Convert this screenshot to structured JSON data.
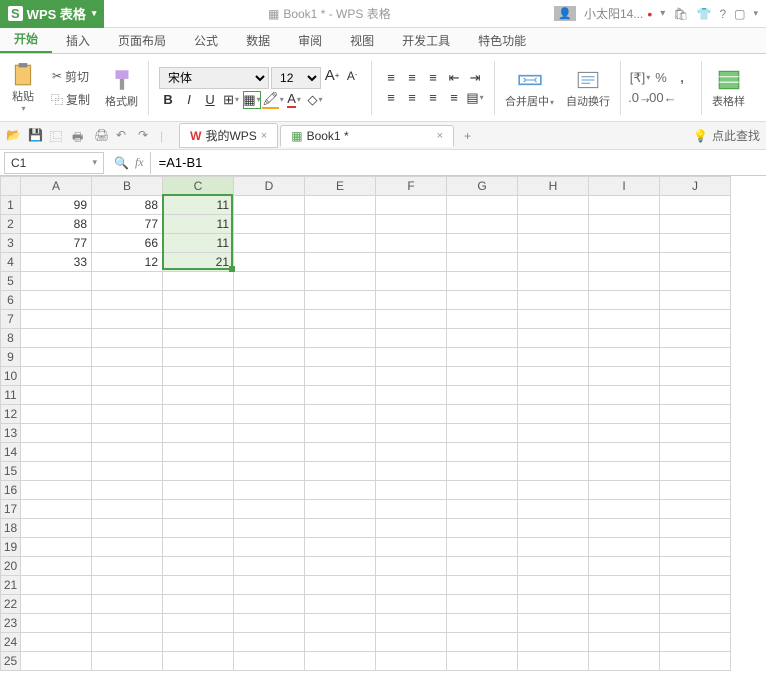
{
  "title": {
    "app": "WPS 表格",
    "doc": "Book1 * - WPS 表格"
  },
  "user": {
    "name": "小太阳14..."
  },
  "menu": {
    "tabs": [
      "开始",
      "插入",
      "页面布局",
      "公式",
      "数据",
      "审阅",
      "视图",
      "开发工具",
      "特色功能"
    ],
    "active": 0
  },
  "ribbon": {
    "paste": "粘贴",
    "cut": "剪切",
    "copy": "复制",
    "format_painter": "格式刷",
    "font_name": "宋体",
    "font_size": "12",
    "merge": "合并居中",
    "wrap": "自动换行",
    "table_style": "表格样"
  },
  "quickbar": {
    "wps_home": "我的WPS",
    "doc_tab": "Book1 *",
    "help": "点此查找"
  },
  "formula": {
    "cell_ref": "C1",
    "formula": "=A1-B1",
    "fx": "fx"
  },
  "chart_data": {
    "type": "table",
    "columns": [
      "A",
      "B",
      "C",
      "D",
      "E",
      "F",
      "G",
      "H",
      "I",
      "J"
    ],
    "rows": [
      {
        "A": 99,
        "B": 88,
        "C": 11
      },
      {
        "A": 88,
        "B": 77,
        "C": 11
      },
      {
        "A": 77,
        "B": 66,
        "C": 11
      },
      {
        "A": 33,
        "B": 12,
        "C": 21
      }
    ],
    "total_rows": 25,
    "selected_range": "C1:C4",
    "active_cell": "C1"
  }
}
